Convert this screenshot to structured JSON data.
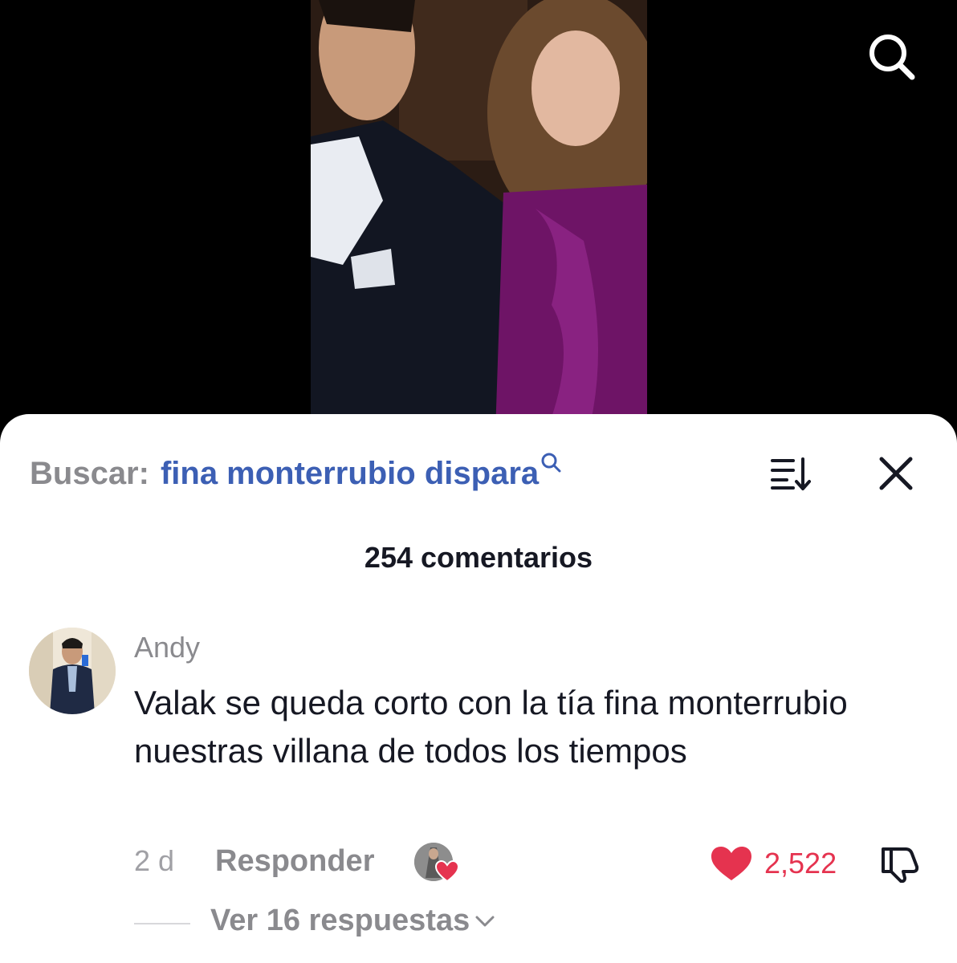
{
  "video": {
    "search_icon": "search-icon"
  },
  "comments_sheet": {
    "search_label": "Buscar:",
    "search_term": "fina monterrubio dispara",
    "sort_icon": "sort-icon",
    "close_icon": "close-icon",
    "count_label": "254 comentarios"
  },
  "comment": {
    "username": "Andy",
    "text": "Valak se queda corto con la tía fina monterrubio nuestras villana de todos los tiempos",
    "time": "2 d",
    "reply_label": "Responder",
    "like_count": "2,522",
    "replies_label": "Ver 16 respuestas",
    "creator_liked": true
  },
  "colors": {
    "search_term": "#3c5fb4",
    "like": "#e5334f",
    "muted": "#8a8a8e",
    "text": "#161823"
  }
}
